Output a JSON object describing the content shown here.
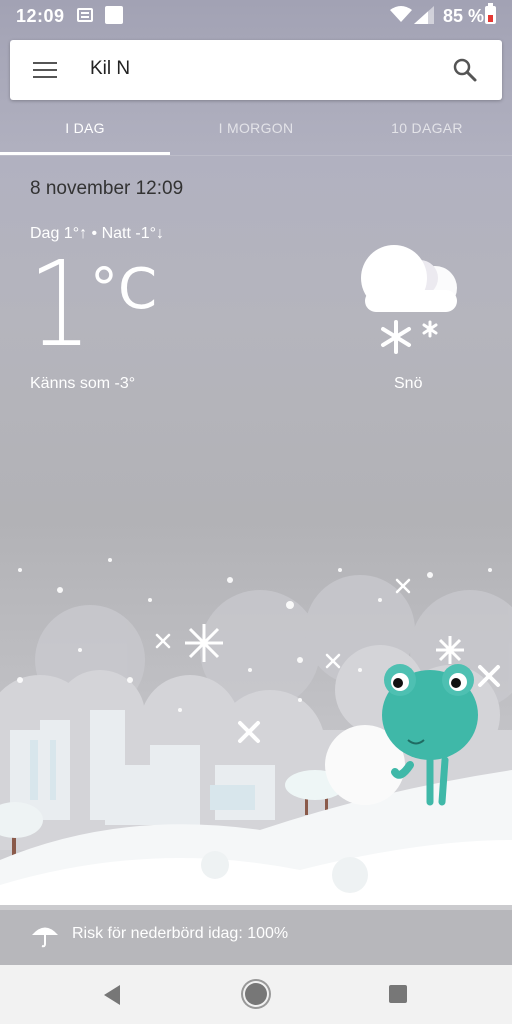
{
  "status_bar": {
    "time": "12:09",
    "battery": "85 %"
  },
  "search": {
    "query": "Kil N"
  },
  "tabs": [
    {
      "label": "I DAG"
    },
    {
      "label": "I MORGON"
    },
    {
      "label": "10 DAGAR"
    }
  ],
  "weather": {
    "datetime": "8 november 12:09",
    "day_night": "Dag 1°↑ • Natt -1°↓",
    "temperature": "1",
    "unit": "°C",
    "feels_like": "Känns som -3°",
    "condition": "Snö"
  },
  "precipitation": {
    "text": "Risk för nederbörd idag: 100%"
  },
  "colors": {
    "sky_top": "#a2a2b4",
    "frog": "#3fb8a8",
    "snow": "#ffffff"
  }
}
